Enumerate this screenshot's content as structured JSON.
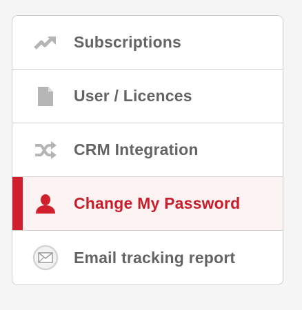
{
  "menu": {
    "items": [
      {
        "label": "Subscriptions",
        "icon": "trending-up-icon",
        "active": false
      },
      {
        "label": "User / Licences",
        "icon": "document-icon",
        "active": false
      },
      {
        "label": "CRM Integration",
        "icon": "shuffle-icon",
        "active": false
      },
      {
        "label": "Change My Password",
        "icon": "user-icon",
        "active": true
      },
      {
        "label": "Email tracking report",
        "icon": "envelope-icon",
        "active": false
      }
    ]
  },
  "colors": {
    "accent": "#d0202e",
    "active_text": "#c81e2c",
    "text": "#646464",
    "icon": "#b5b5b5",
    "border": "#cfcfcf",
    "active_bg": "#fdf3f3"
  }
}
